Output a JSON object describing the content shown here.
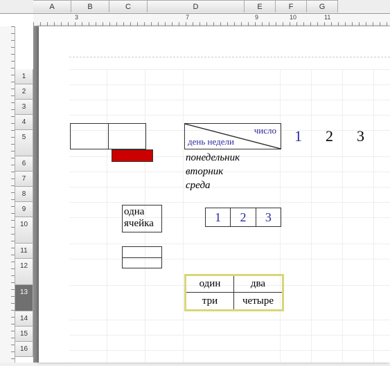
{
  "columns": [
    "A",
    "B",
    "C",
    "D",
    "E",
    "F",
    "G"
  ],
  "rows": [
    "1",
    "2",
    "3",
    "4",
    "5",
    "6",
    "7",
    "8",
    "9",
    "10",
    "11",
    "12",
    "13",
    "14",
    "15",
    "16"
  ],
  "selected_row": "13",
  "ruler_marks": [
    "3",
    "7",
    "9",
    "10",
    "11"
  ],
  "diag": {
    "top": "число",
    "bottom": "день недели"
  },
  "side_nums": [
    "1",
    "2",
    "3"
  ],
  "days": [
    "понедельник",
    "вторник",
    "среда"
  ],
  "one_cell": "одна ячейка",
  "nums123": [
    "1",
    "2",
    "3"
  ],
  "grid2x2": [
    "один",
    "два",
    "три",
    "четыре"
  ]
}
